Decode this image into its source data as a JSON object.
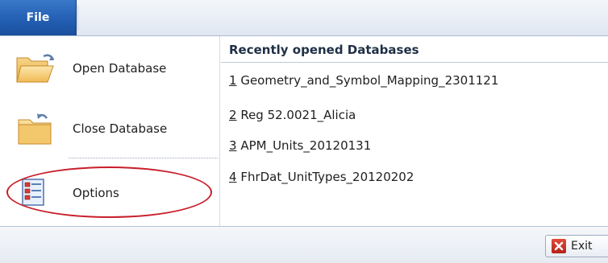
{
  "ribbon": {
    "file_tab_label": "File"
  },
  "commands": {
    "open_label": "Open Database",
    "close_label": "Close Database",
    "options_label": "Options"
  },
  "recent": {
    "title": "Recently opened Databases",
    "items": [
      {
        "num": "1",
        "name": " Geometry_and_Symbol_Mapping_2301121"
      },
      {
        "num": "2",
        "name": " Reg 52.0021_Alicia"
      },
      {
        "num": "3",
        "name": " APM_Units_20120131"
      },
      {
        "num": "4",
        "name": " FhrDat_UnitTypes_20120202"
      }
    ]
  },
  "footer": {
    "exit_label": "Exit"
  },
  "icons": {
    "open": "open-folder-icon",
    "close": "close-folder-icon",
    "options": "options-icon",
    "exit": "exit-icon"
  },
  "colors": {
    "file_tab": "#235fb3",
    "highlight_ellipse": "#c81e2a",
    "exit_icon": "#c92a1f"
  }
}
